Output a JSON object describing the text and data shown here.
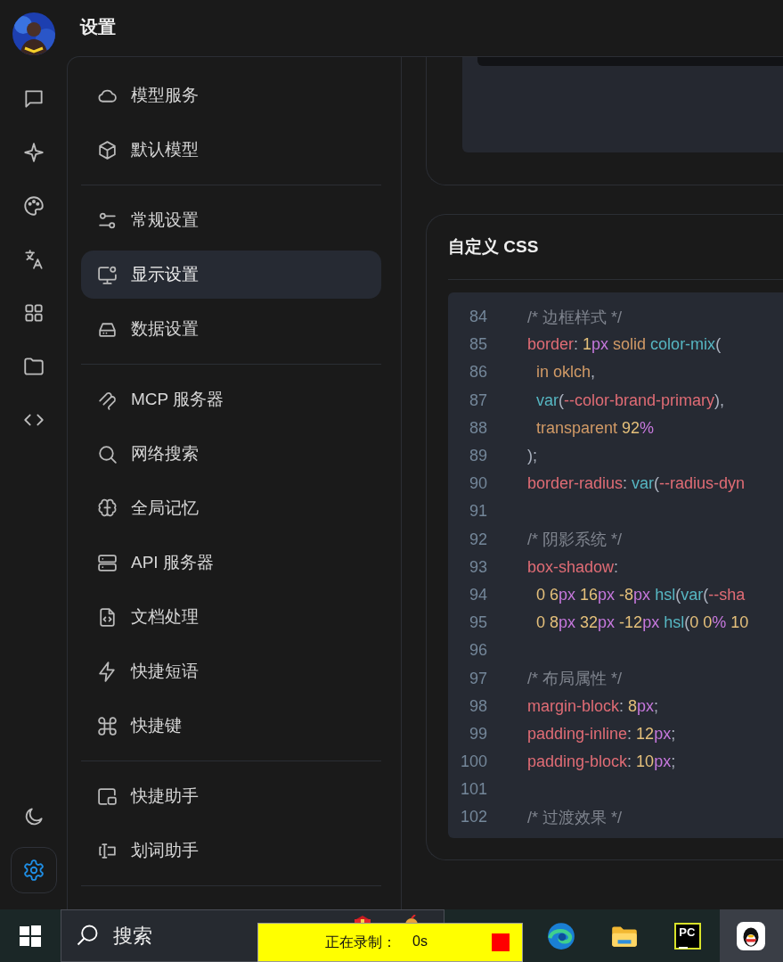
{
  "header": {
    "title": "设置"
  },
  "rail": {
    "items": [
      {
        "kind": "chat",
        "selected": false
      },
      {
        "kind": "sparkle",
        "selected": false
      },
      {
        "kind": "palette",
        "selected": false
      },
      {
        "kind": "translate",
        "selected": false
      },
      {
        "kind": "grid",
        "selected": false
      },
      {
        "kind": "folder",
        "selected": false
      },
      {
        "kind": "code",
        "selected": false
      }
    ],
    "bottom": [
      {
        "kind": "moon",
        "selected": false
      },
      {
        "kind": "gear",
        "selected": true
      }
    ]
  },
  "menu": {
    "groups": [
      {
        "items": [
          {
            "kind": "cloud",
            "label": "模型服务",
            "selected": false
          },
          {
            "kind": "cube",
            "label": "默认模型",
            "selected": false
          }
        ]
      },
      {
        "items": [
          {
            "kind": "sliders",
            "label": "常规设置",
            "selected": false
          },
          {
            "kind": "monitor",
            "label": "显示设置",
            "selected": true
          },
          {
            "kind": "drive",
            "label": "数据设置",
            "selected": false
          }
        ]
      },
      {
        "items": [
          {
            "kind": "ribbon",
            "label": "MCP 服务器",
            "selected": false
          },
          {
            "kind": "search",
            "label": "网络搜索",
            "selected": false
          },
          {
            "kind": "brain",
            "label": "全局记忆",
            "selected": false
          },
          {
            "kind": "server",
            "label": "API 服务器",
            "selected": false
          },
          {
            "kind": "file",
            "label": "文档处理",
            "selected": false
          },
          {
            "kind": "zap",
            "label": "快捷短语",
            "selected": false
          },
          {
            "kind": "command",
            "label": "快捷键",
            "selected": false
          }
        ]
      },
      {
        "items": [
          {
            "kind": "window",
            "label": "快捷助手",
            "selected": false
          },
          {
            "kind": "cursor",
            "label": "划词助手",
            "selected": false
          }
        ]
      }
    ]
  },
  "custom_css": {
    "title": "自定义 CSS",
    "lines": [
      {
        "number": "84",
        "tokens": [
          {
            "kind": "comment",
            "text": "/* 边框样式 */"
          }
        ]
      },
      {
        "number": "85",
        "tokens": [
          {
            "kind": "prop",
            "text": "border"
          },
          {
            "kind": "punct",
            "text": ": "
          },
          {
            "kind": "num",
            "text": "1"
          },
          {
            "kind": "unit",
            "text": "px"
          },
          {
            "kind": "value",
            "text": " solid "
          },
          {
            "kind": "fn",
            "text": "color-mix"
          },
          {
            "kind": "punct",
            "text": "("
          }
        ]
      },
      {
        "number": "86",
        "tokens": [
          {
            "kind": "value",
            "text": "  in oklch"
          },
          {
            "kind": "punct",
            "text": ","
          }
        ]
      },
      {
        "number": "87",
        "tokens": [
          {
            "kind": "fn",
            "text": "  var"
          },
          {
            "kind": "punct",
            "text": "("
          },
          {
            "kind": "prop",
            "text": "--color-brand-primary"
          },
          {
            "kind": "punct",
            "text": "),"
          }
        ]
      },
      {
        "number": "88",
        "tokens": [
          {
            "kind": "value",
            "text": "  transparent "
          },
          {
            "kind": "num",
            "text": "92"
          },
          {
            "kind": "unit",
            "text": "%"
          }
        ]
      },
      {
        "number": "89",
        "tokens": [
          {
            "kind": "punct",
            "text": ");"
          }
        ]
      },
      {
        "number": "90",
        "tokens": [
          {
            "kind": "prop",
            "text": "border-radius"
          },
          {
            "kind": "punct",
            "text": ": "
          },
          {
            "kind": "fn",
            "text": "var"
          },
          {
            "kind": "punct",
            "text": "("
          },
          {
            "kind": "prop",
            "text": "--radius-dyn"
          }
        ]
      },
      {
        "number": "91"
      },
      {
        "number": "92",
        "tokens": [
          {
            "kind": "comment",
            "text": "/* 阴影系统 */"
          }
        ]
      },
      {
        "number": "93",
        "tokens": [
          {
            "kind": "prop",
            "text": "box-shadow"
          },
          {
            "kind": "punct",
            "text": ":"
          }
        ]
      },
      {
        "number": "94",
        "tokens": [
          {
            "kind": "num",
            "text": "  0 6"
          },
          {
            "kind": "unit",
            "text": "px"
          },
          {
            "kind": "num",
            "text": " 16"
          },
          {
            "kind": "unit",
            "text": "px"
          },
          {
            "kind": "num",
            "text": " -8"
          },
          {
            "kind": "unit",
            "text": "px"
          },
          {
            "kind": "fn",
            "text": " hsl"
          },
          {
            "kind": "punct",
            "text": "("
          },
          {
            "kind": "fn",
            "text": "var"
          },
          {
            "kind": "punct",
            "text": "("
          },
          {
            "kind": "prop",
            "text": "--sha"
          }
        ]
      },
      {
        "number": "95",
        "tokens": [
          {
            "kind": "num",
            "text": "  0 8"
          },
          {
            "kind": "unit",
            "text": "px"
          },
          {
            "kind": "num",
            "text": " 32"
          },
          {
            "kind": "unit",
            "text": "px"
          },
          {
            "kind": "num",
            "text": " -12"
          },
          {
            "kind": "unit",
            "text": "px"
          },
          {
            "kind": "fn",
            "text": " hsl"
          },
          {
            "kind": "punct",
            "text": "("
          },
          {
            "kind": "num",
            "text": "0 0"
          },
          {
            "kind": "unit",
            "text": "%"
          },
          {
            "kind": "num",
            "text": " 10"
          }
        ]
      },
      {
        "number": "96"
      },
      {
        "number": "97",
        "tokens": [
          {
            "kind": "comment",
            "text": "/* 布局属性 */"
          }
        ]
      },
      {
        "number": "98",
        "tokens": [
          {
            "kind": "prop",
            "text": "margin-block"
          },
          {
            "kind": "punct",
            "text": ": "
          },
          {
            "kind": "num",
            "text": "8"
          },
          {
            "kind": "unit",
            "text": "px"
          },
          {
            "kind": "punct",
            "text": ";"
          }
        ]
      },
      {
        "number": "99",
        "tokens": [
          {
            "kind": "prop",
            "text": "padding-inline"
          },
          {
            "kind": "punct",
            "text": ": "
          },
          {
            "kind": "num",
            "text": "12"
          },
          {
            "kind": "unit",
            "text": "px"
          },
          {
            "kind": "punct",
            "text": ";"
          }
        ]
      },
      {
        "number": "100",
        "tokens": [
          {
            "kind": "prop",
            "text": "padding-block"
          },
          {
            "kind": "punct",
            "text": ": "
          },
          {
            "kind": "num",
            "text": "10"
          },
          {
            "kind": "unit",
            "text": "px"
          },
          {
            "kind": "punct",
            "text": ";"
          }
        ]
      },
      {
        "number": "101"
      },
      {
        "number": "102",
        "tokens": [
          {
            "kind": "comment",
            "text": "/* 过渡效果 */"
          }
        ]
      }
    ]
  },
  "taskbar": {
    "search": {
      "placeholder": "搜索"
    },
    "recorder": {
      "status": "正在录制：",
      "time": "0s"
    },
    "apps": [
      {
        "kind": "browser",
        "selected": false
      },
      {
        "kind": "files",
        "selected": false
      },
      {
        "kind": "ide",
        "text": "PC",
        "selected": false
      },
      {
        "kind": "penguin",
        "selected": true
      }
    ]
  }
}
